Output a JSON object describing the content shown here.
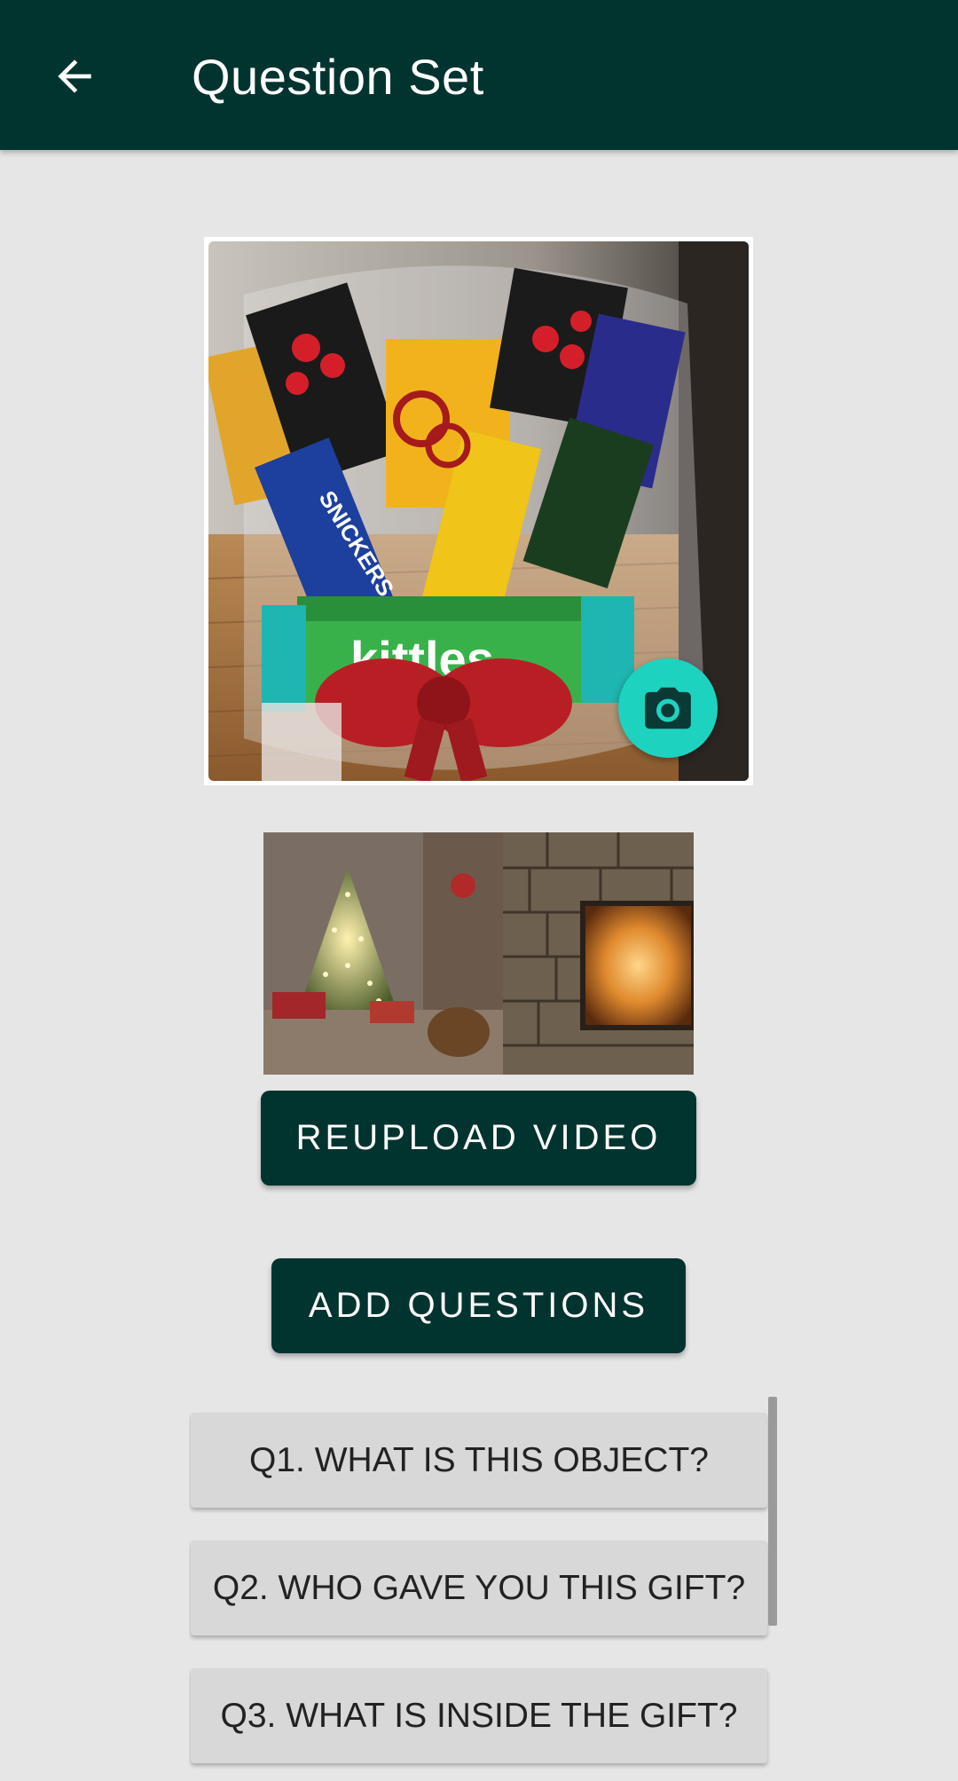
{
  "app_bar": {
    "title": "Question Set",
    "back_icon": "arrow-left-icon",
    "background": "#01342f"
  },
  "image_card": {
    "camera_icon": "camera-icon",
    "fab_color": "#1dd3c0"
  },
  "video": {
    "thumbnail_icon": "video-thumbnail"
  },
  "buttons": {
    "reupload_label": "REUPLOAD VIDEO",
    "add_questions_label": "ADD QUESTIONS",
    "color": "#01342f"
  },
  "questions": [
    {
      "label": "Q1. WHAT IS THIS OBJECT?"
    },
    {
      "label": "Q2. WHO GAVE YOU THIS GIFT?"
    },
    {
      "label": "Q3. WHAT IS INSIDE THE GIFT?"
    }
  ]
}
